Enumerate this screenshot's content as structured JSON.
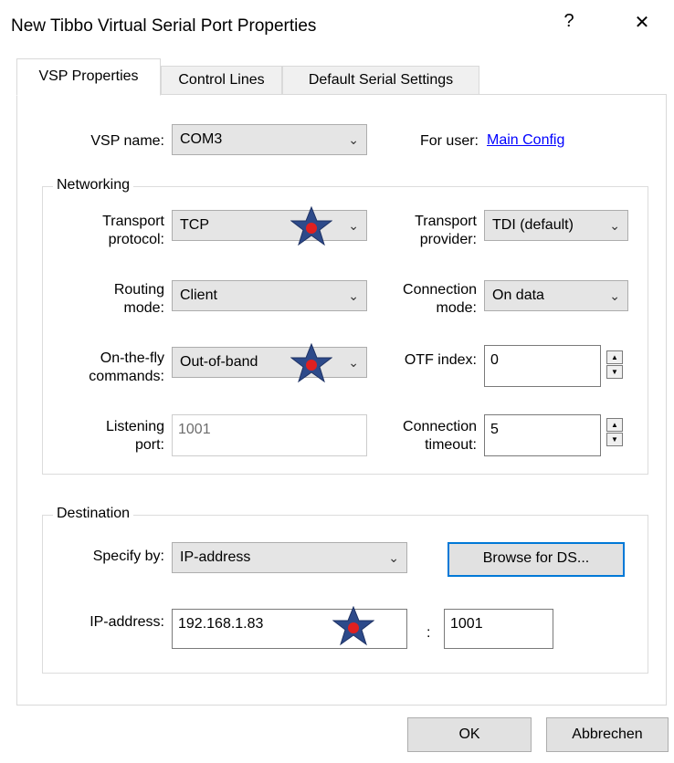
{
  "window": {
    "title": "New Tibbo Virtual Serial Port Properties",
    "help_label": "?",
    "close_label": "✕"
  },
  "tabs": [
    {
      "label": "VSP Properties",
      "active": true
    },
    {
      "label": "Control Lines",
      "active": false
    },
    {
      "label": "Default Serial Settings",
      "active": false
    }
  ],
  "vsp": {
    "name_label": "VSP name:",
    "name_value": "COM3",
    "user_label": "For user:",
    "user_link": "Main Config"
  },
  "networking": {
    "legend": "Networking",
    "transport_protocol": {
      "label1": "Transport",
      "label2": "protocol:",
      "value": "TCP"
    },
    "transport_provider": {
      "label1": "Transport",
      "label2": "provider:",
      "value": "TDI (default)"
    },
    "routing_mode": {
      "label1": "Routing",
      "label2": "mode:",
      "value": "Client"
    },
    "connection_mode": {
      "label1": "Connection",
      "label2": "mode:",
      "value": "On data"
    },
    "otf_commands": {
      "label1": "On-the-fly",
      "label2": "commands:",
      "value": "Out-of-band"
    },
    "otf_index": {
      "label": "OTF index:",
      "value": "0"
    },
    "listening_port": {
      "label1": "Listening",
      "label2": "port:",
      "value": "1001"
    },
    "connection_timeout": {
      "label1": "Connection",
      "label2": "timeout:",
      "value": "5"
    }
  },
  "destination": {
    "legend": "Destination",
    "specify_label": "Specify by:",
    "specify_value": "IP-address",
    "browse_label": "Browse for DS...",
    "ip_label": "IP-address:",
    "ip_value": "192.168.1.83",
    "port_sep": ":",
    "port_value": "1001"
  },
  "footer": {
    "ok_label": "OK",
    "cancel_label": "Abbrechen"
  },
  "icons": {
    "dropdown": "chevron-down-icon",
    "spin_up": "triangle-up-icon",
    "spin_down": "triangle-down-icon",
    "marker": "star-marker-icon"
  },
  "colors": {
    "star_fill": "#2d4a8a",
    "star_center": "#e02020",
    "link": "#0000ff",
    "focus": "#0078d7"
  }
}
